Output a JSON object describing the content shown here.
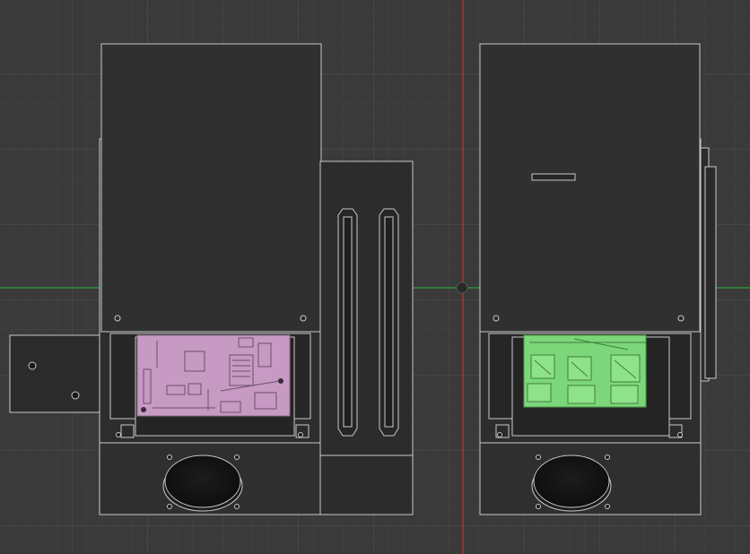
{
  "colors": {
    "background": "#3a3a3a",
    "grid_minor": "#434343",
    "grid_major": "#4d4d4d",
    "axis_x": "#2fa03a",
    "axis_y": "#b8342f",
    "body_fill": "#2e2e2e",
    "body_fill_dark": "#262626",
    "edge": "#c9c9c9",
    "board_highlight_pink": "#c79ac3",
    "board_highlight_green": "#7cd67a"
  },
  "scene": {
    "view": "top",
    "model_left": {
      "name": "enclosure-with-control-board",
      "board_highlight": "pink"
    },
    "model_right": {
      "name": "enclosure-with-relay-board",
      "board_highlight": "green"
    },
    "rail_block": {
      "name": "dual-slot-rail-block"
    }
  }
}
